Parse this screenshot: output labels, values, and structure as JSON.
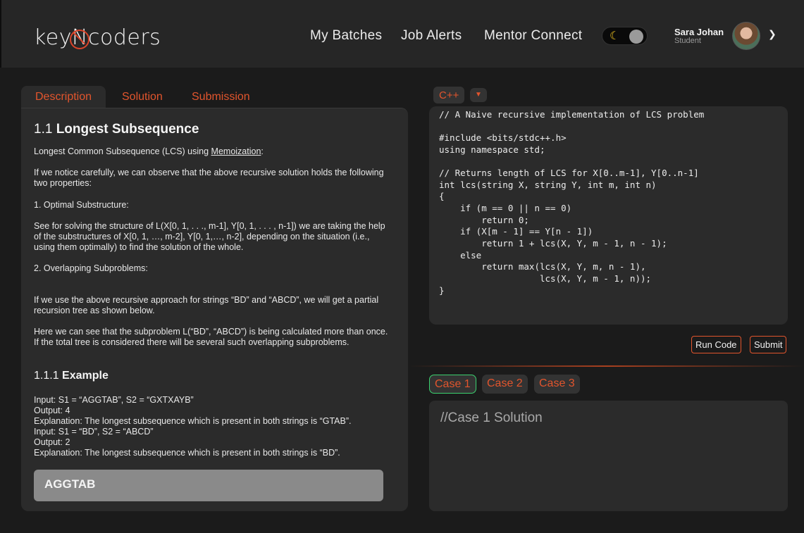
{
  "header": {
    "logo": {
      "pre": "key",
      "mark": "N",
      "post": "coders"
    },
    "nav": [
      "My Batches",
      "Job Alerts",
      "Mentor Connect"
    ],
    "theme_toggle": {
      "icon": "moon-icon",
      "glyph": "☾"
    },
    "user": {
      "name": "Sara Johan",
      "role": "Student"
    }
  },
  "problem_tabs": [
    "Description",
    "Solution",
    "Submission"
  ],
  "description": {
    "number": "1.1",
    "title": "Longest Subsequence",
    "intro_prefix": "Longest Common Subsequence (LCS) using ",
    "intro_link": "Memoization",
    "intro_suffix": ":",
    "p2": "If we notice carefully, we can observe that the above recursive solution holds the following two properties:",
    "p3": "1. Optimal Substructure:",
    "p4": "See for solving the structure of L(X[0, 1, . . ., m-1], Y[0, 1, . . . , n-1]) we are taking the help of the substructures of X[0, 1, …, m-2], Y[0, 1,…, n-2], depending on the situation (i.e., using them optimally) to find the solution of the whole.",
    "p5": "2. Overlapping Subproblems:",
    "p6": "If we use the above recursive approach for strings “BD” and “ABCD”, we will get a partial recursion tree as shown below.",
    "p7": "Here we can see that the subproblem L(“BD”, “ABCD”) is being calculated more than once. If the total tree is considered there will be several such overlapping subproblems.",
    "example_number": "1.1.1",
    "example_title": "Example",
    "example_lines": [
      "Input: S1 = “AGGTAB”, S2 = “GXTXAYB”",
      "Output: 4",
      "Explanation: The longest subsequence which is present in both strings is “GTAB”.",
      "Input: S1 = “BD”, S2 = “ABCD”",
      "Output: 2",
      "Explanation: The longest subsequence which is present in both strings is “BD”."
    ],
    "answer": "AGGTAB"
  },
  "editor": {
    "language": "C++",
    "code_lines": [
      "// A Naive recursive implementation of LCS problem",
      "",
      "#include <bits/stdc++.h>",
      "using namespace std;",
      "",
      "// Returns length of LCS for X[0..m-1], Y[0..n-1]",
      "int lcs(string X, string Y, int m, int n)",
      "{",
      "    if (m == 0 || n == 0)",
      "        return 0;",
      "    if (X[m - 1] == Y[n - 1])",
      "        return 1 + lcs(X, Y, m - 1, n - 1);",
      "    else",
      "        return max(lcs(X, Y, m, n - 1),",
      "                   lcs(X, Y, m - 1, n));",
      "}"
    ],
    "run_label": "Run Code",
    "submit_label": "Submit"
  },
  "cases": [
    "Case 1",
    "Case 2",
    "Case 3"
  ],
  "output": "//Case 1 Solution",
  "colors": {
    "accent": "#e2552d",
    "active_case": "#3bd16f",
    "panel": "#2b2b2b"
  }
}
